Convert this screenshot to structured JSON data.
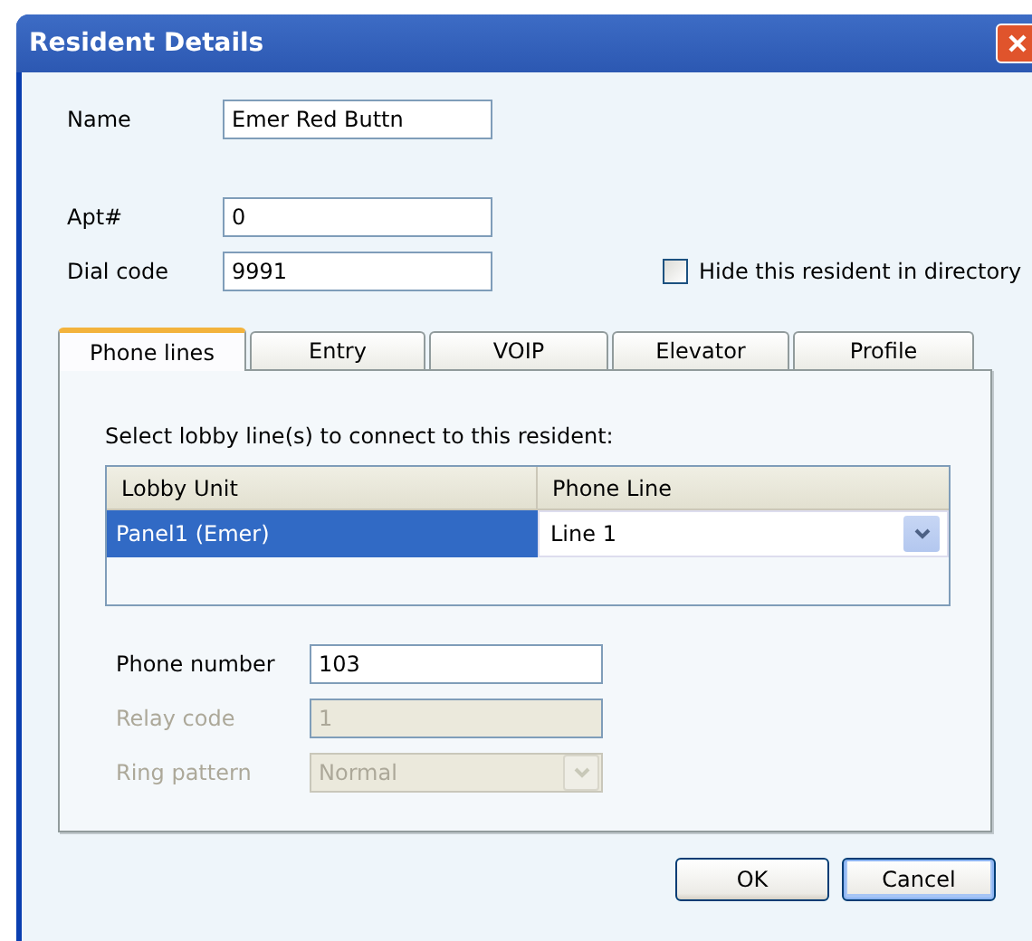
{
  "window": {
    "title": "Resident Details"
  },
  "fields": [
    {
      "label": "Name",
      "value": "Emer Red Buttn"
    },
    {
      "label": "Apt#",
      "value": "0"
    },
    {
      "label": "Dial code",
      "value": "9991"
    }
  ],
  "hide_in_directory": {
    "label": "Hide this resident in directory",
    "checked": false
  },
  "tabs": [
    {
      "label": "Phone lines",
      "selected": true
    },
    {
      "label": "Entry",
      "selected": false
    },
    {
      "label": "VOIP",
      "selected": false
    },
    {
      "label": "Elevator",
      "selected": false
    },
    {
      "label": "Profile",
      "selected": false
    }
  ],
  "phone_lines": {
    "instruction": "Select lobby line(s) to connect to this resident:",
    "table": {
      "columns": [
        "Lobby Unit",
        "Phone Line"
      ],
      "rows": [
        {
          "lobby_unit": "Panel1 (Emer)",
          "phone_line": "Line 1",
          "selected": true
        }
      ]
    },
    "settings": [
      {
        "kind": "text",
        "label": "Phone number",
        "value": "103",
        "disabled": false
      },
      {
        "kind": "text",
        "label": "Relay code",
        "value": "1",
        "disabled": true
      },
      {
        "kind": "dropdown",
        "label": "Ring pattern",
        "value": "Normal",
        "disabled": true
      }
    ]
  },
  "buttons": [
    {
      "label": "OK",
      "default": false
    },
    {
      "label": "Cancel",
      "default": true
    }
  ]
}
